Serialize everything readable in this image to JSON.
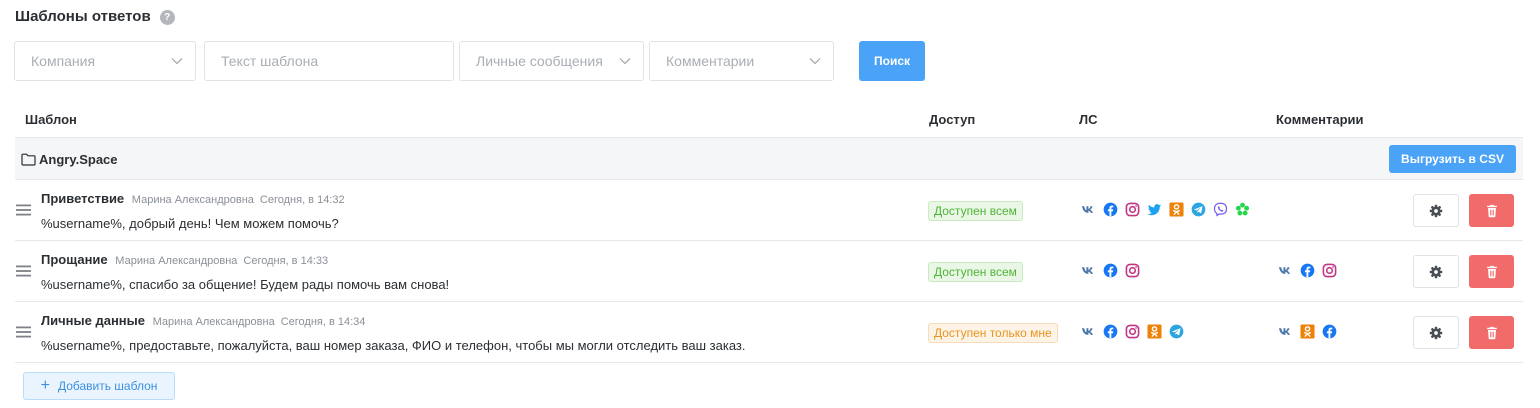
{
  "header": {
    "title": "Шаблоны ответов",
    "help_glyph": "?"
  },
  "filters": {
    "company_placeholder": "Компания",
    "template_text_placeholder": "Текст шаблона",
    "direct_messages_placeholder": "Личные сообщения",
    "comments_placeholder": "Комментарии",
    "search_label": "Поиск"
  },
  "table": {
    "headers": {
      "template": "Шаблон",
      "access": "Доступ",
      "dm": "ЛС",
      "comments": "Комментарии"
    },
    "group": {
      "name": "Angry.Space",
      "export_label": "Выгрузить в CSV"
    },
    "rows": [
      {
        "title": "Приветствие",
        "author": "Марина Александровна",
        "time": "Сегодня, в 14:32",
        "text": "%username%, добрый день! Чем можем помочь?",
        "access": "Доступен всем",
        "access_color": "green",
        "dm_icons": [
          "vk-icon",
          "facebook-icon",
          "instagram-icon",
          "twitter-icon",
          "odnoklassniki-icon",
          "telegram-icon",
          "viber-icon",
          "icq-icon"
        ],
        "comment_icons": []
      },
      {
        "title": "Прощание",
        "author": "Марина Александровна",
        "time": "Сегодня, в 14:33",
        "text": "%username%, спасибо за общение! Будем рады помочь вам снова!",
        "access": "Доступен всем",
        "access_color": "green",
        "dm_icons": [
          "vk-icon",
          "facebook-icon",
          "instagram-icon"
        ],
        "comment_icons": [
          "vk-icon",
          "facebook-icon",
          "instagram-icon"
        ]
      },
      {
        "title": "Личные данные",
        "author": "Марина Александровна",
        "time": "Сегодня, в 14:34",
        "text": "%username%, предоставьте, пожалуйста, ваш номер заказа, ФИО и телефон, чтобы мы могли отследить ваш заказ.",
        "access": "Доступен только мне",
        "access_color": "orange",
        "dm_icons": [
          "vk-icon",
          "facebook-icon",
          "instagram-icon",
          "odnoklassniki-icon",
          "telegram-icon"
        ],
        "comment_icons": [
          "vk-icon",
          "odnoklassniki-icon",
          "facebook-icon"
        ]
      }
    ]
  },
  "footer": {
    "add_label": "Добавить шаблон"
  },
  "colors": {
    "primary": "#4aa3f7",
    "danger": "#f26b6b",
    "vk": "#4a76a8",
    "facebook": "#1877f2",
    "instagram": "#c13584",
    "twitter": "#1da1f2",
    "odnoklassniki": "#ee8208",
    "telegram": "#2ca5e0",
    "viber": "#7360f2",
    "icq": "#24d64a"
  }
}
